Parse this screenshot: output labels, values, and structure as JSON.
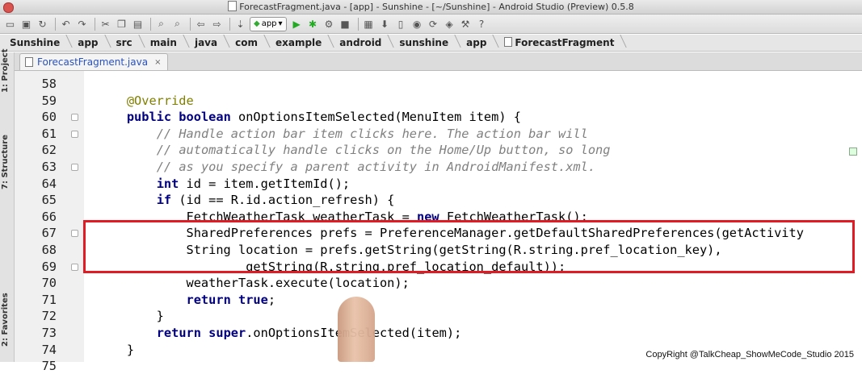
{
  "window": {
    "title": "ForecastFragment.java - [app] - Sunshine - [~/Sunshine] - Android Studio (Preview) 0.5.8"
  },
  "toolbar": {
    "app_selector": "app"
  },
  "breadcrumb": [
    "Sunshine",
    "app",
    "src",
    "main",
    "java",
    "com",
    "example",
    "android",
    "sunshine",
    "app",
    "ForecastFragment"
  ],
  "tool_windows": {
    "project": "1: Project",
    "structure": "7: Structure",
    "favorites": "2: Favorites"
  },
  "tab": {
    "label": "ForecastFragment.java",
    "close": "×"
  },
  "code_lines": [
    {
      "num": "58",
      "indent": "",
      "segments": []
    },
    {
      "num": "59",
      "segments": [
        {
          "t": "    ",
          "c": ""
        },
        {
          "t": "@Override",
          "c": "an"
        }
      ]
    },
    {
      "num": "60",
      "segments": [
        {
          "t": "    ",
          "c": ""
        },
        {
          "t": "public boolean",
          "c": "kw"
        },
        {
          "t": " onOptionsItemSelected(MenuItem item) {",
          "c": ""
        }
      ]
    },
    {
      "num": "61",
      "segments": [
        {
          "t": "        ",
          "c": ""
        },
        {
          "t": "// Handle action bar item clicks here. The action bar will",
          "c": "cm"
        }
      ]
    },
    {
      "num": "62",
      "segments": [
        {
          "t": "        ",
          "c": ""
        },
        {
          "t": "// automatically handle clicks on the Home/Up button, so long",
          "c": "cm"
        }
      ]
    },
    {
      "num": "63",
      "segments": [
        {
          "t": "        ",
          "c": ""
        },
        {
          "t": "// as you specify a parent activity in AndroidManifest.xml.",
          "c": "cm"
        }
      ]
    },
    {
      "num": "64",
      "segments": [
        {
          "t": "        ",
          "c": ""
        },
        {
          "t": "int",
          "c": "kw"
        },
        {
          "t": " id = item.getItemId();",
          "c": ""
        }
      ]
    },
    {
      "num": "65",
      "segments": [
        {
          "t": "        ",
          "c": ""
        },
        {
          "t": "if",
          "c": "kw"
        },
        {
          "t": " (id == R.id.action_refresh) {",
          "c": ""
        }
      ]
    },
    {
      "num": "66",
      "segments": [
        {
          "t": "            FetchWeatherTask weatherTask = ",
          "c": ""
        },
        {
          "t": "new",
          "c": "kw"
        },
        {
          "t": " FetchWeatherTask();",
          "c": ""
        }
      ]
    },
    {
      "num": "67",
      "segments": [
        {
          "t": "            SharedPreferences prefs = PreferenceManager.getDefaultSharedPreferences(getActivity",
          "c": ""
        }
      ]
    },
    {
      "num": "68",
      "segments": [
        {
          "t": "            String location = prefs.getString(getString(R.string.pref_location_key),",
          "c": ""
        }
      ]
    },
    {
      "num": "69",
      "segments": [
        {
          "t": "                    getString(R.string.pref_location_default));",
          "c": ""
        }
      ]
    },
    {
      "num": "70",
      "segments": [
        {
          "t": "            weatherTask.execute(location);",
          "c": ""
        }
      ]
    },
    {
      "num": "71",
      "segments": [
        {
          "t": "            ",
          "c": ""
        },
        {
          "t": "return true",
          "c": "kw"
        },
        {
          "t": ";",
          "c": ""
        }
      ]
    },
    {
      "num": "72",
      "segments": [
        {
          "t": "        }",
          "c": ""
        }
      ]
    },
    {
      "num": "73",
      "segments": [
        {
          "t": "        ",
          "c": ""
        },
        {
          "t": "return super",
          "c": "kw"
        },
        {
          "t": ".onOptionsItemSelected(item);",
          "c": ""
        }
      ]
    },
    {
      "num": "74",
      "segments": [
        {
          "t": "    }",
          "c": ""
        }
      ]
    },
    {
      "num": "75",
      "segments": []
    }
  ],
  "watermark": "CopyRight @TalkCheap_ShowMeCode_Studio 2015",
  "colors": {
    "keyword": "#000080",
    "comment": "#808080",
    "annotation": "#808000",
    "highlight_box": "#e01b24"
  }
}
